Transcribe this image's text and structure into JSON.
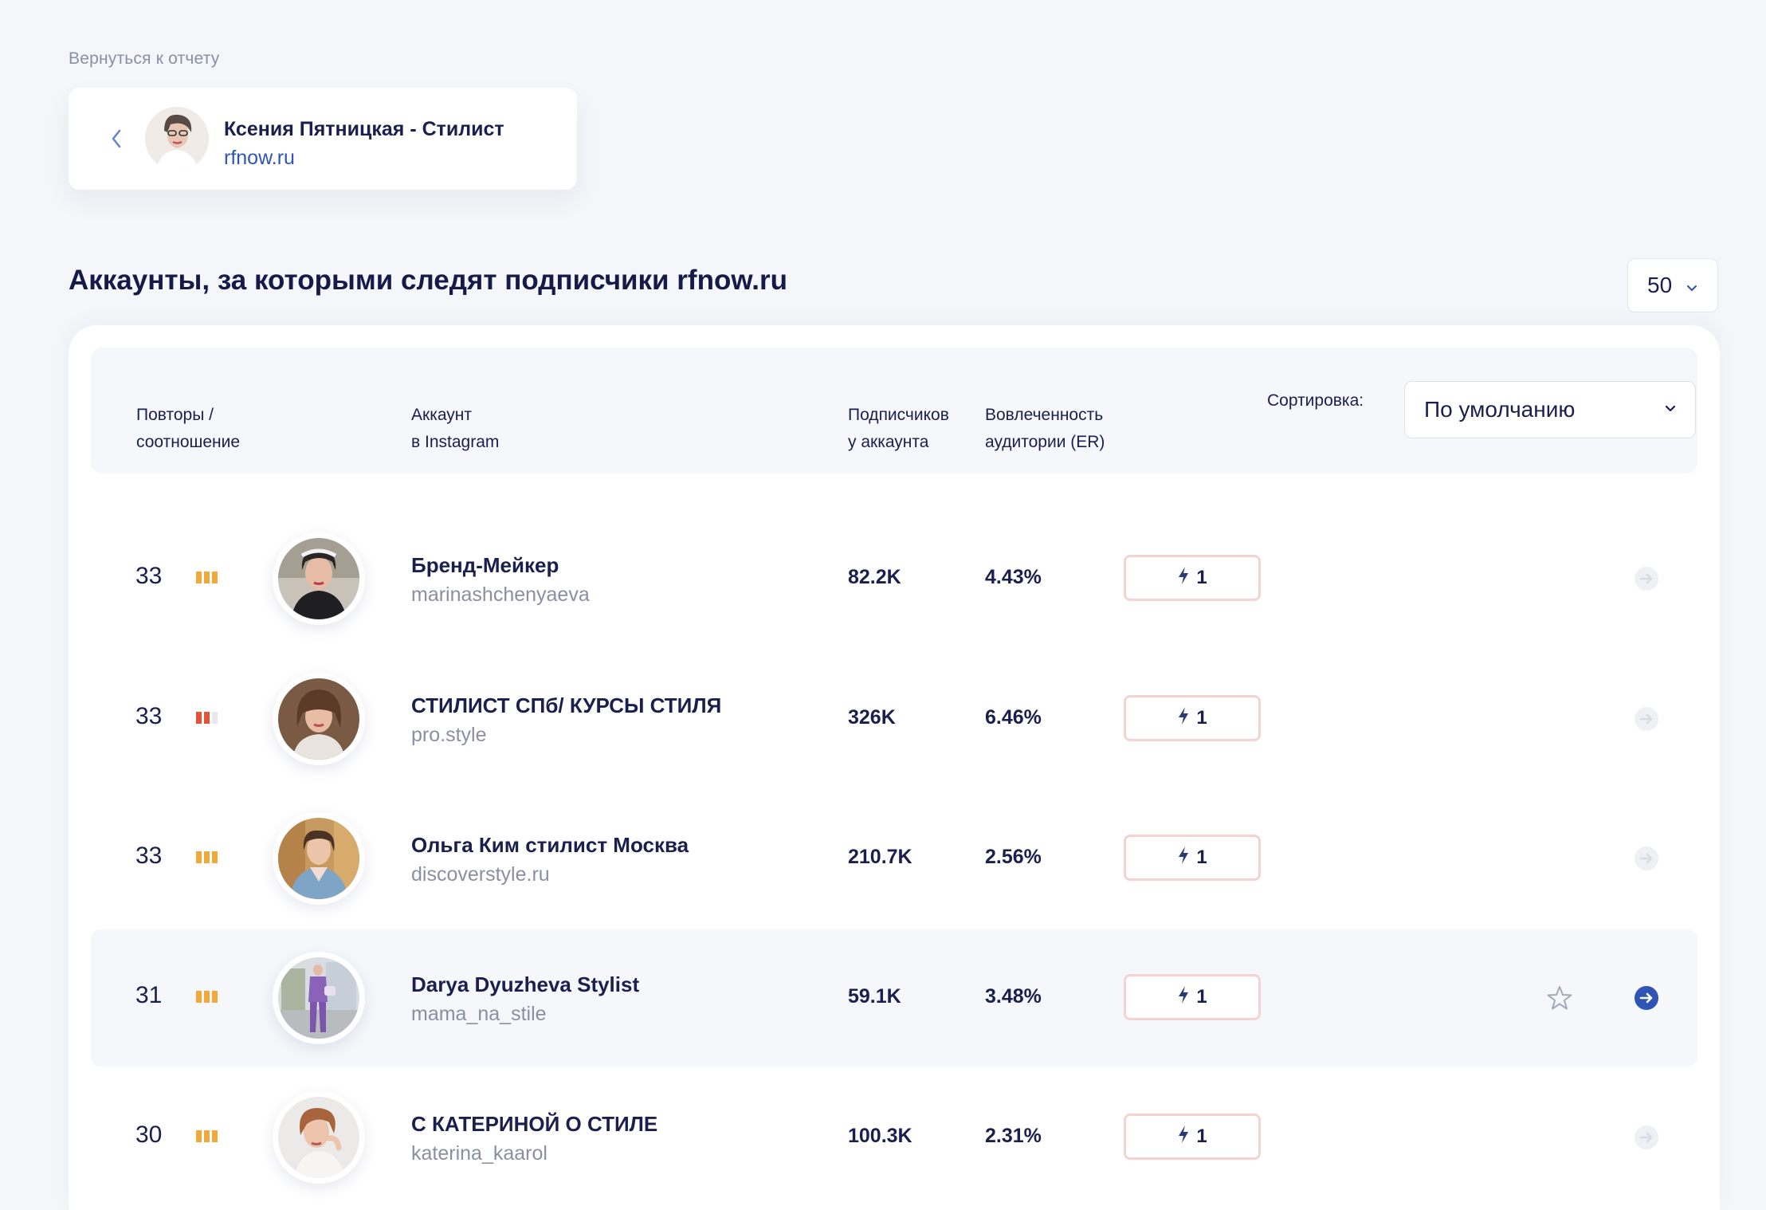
{
  "back_link": "Вернуться к отчету",
  "profile": {
    "name": "Ксения Пятницкая - Стилист",
    "domain": "rfnow.ru"
  },
  "section_title": "Аккаунты, за которыми следят подписчики rfnow.ru",
  "per_page": "50",
  "table": {
    "headers": {
      "repeats": [
        "Повторы /",
        "соотношение"
      ],
      "account": [
        "Аккаунт",
        "в Instagram"
      ],
      "followers": [
        "Подписчиков",
        "у аккаунта"
      ],
      "engagement": [
        "Вовлеченность",
        "аудитории (ER)"
      ]
    },
    "sort_label": "Сортировка:",
    "sort_value": "По умолчанию",
    "rows": [
      {
        "count": "33",
        "ratio_level": 3,
        "ratio_color": "#f0a93a",
        "name": "Бренд-Мейкер",
        "username": "marinashchenyaeva",
        "followers": "82.2K",
        "er": "4.43%",
        "badge": "1",
        "highlighted": false
      },
      {
        "count": "33",
        "ratio_level": 2,
        "ratio_color": "#e5523a",
        "name": "СТИЛИСТ СПб/ КУРСЫ СТИЛЯ",
        "username": "pro.style",
        "followers": "326K",
        "er": "6.46%",
        "badge": "1",
        "highlighted": false
      },
      {
        "count": "33",
        "ratio_level": 3,
        "ratio_color": "#f0a93a",
        "name": "Ольга Ким стилист Москва",
        "username": "discoverstyle.ru",
        "followers": "210.7K",
        "er": "2.56%",
        "badge": "1",
        "highlighted": false
      },
      {
        "count": "31",
        "ratio_level": 3,
        "ratio_color": "#f0a93a",
        "name": "Darya Dyuzheva Stylist",
        "username": "mama_na_stile",
        "followers": "59.1K",
        "er": "3.48%",
        "badge": "1",
        "highlighted": true
      },
      {
        "count": "30",
        "ratio_level": 3,
        "ratio_color": "#f0a93a",
        "name": "С КАТЕРИНОЙ О СТИЛЕ",
        "username": "katerina_kaarol",
        "followers": "100.3K",
        "er": "2.31%",
        "badge": "1",
        "highlighted": false
      }
    ]
  },
  "colors": {
    "accent": "#2f55b4",
    "text": "#1a1f4d",
    "muted": "#8a8fa3",
    "badge_border": "#f6d3d3"
  },
  "icons": [
    "chevron-left-icon",
    "chevron-down-icon",
    "lightning-icon",
    "star-icon",
    "arrow-right-circle-icon"
  ]
}
